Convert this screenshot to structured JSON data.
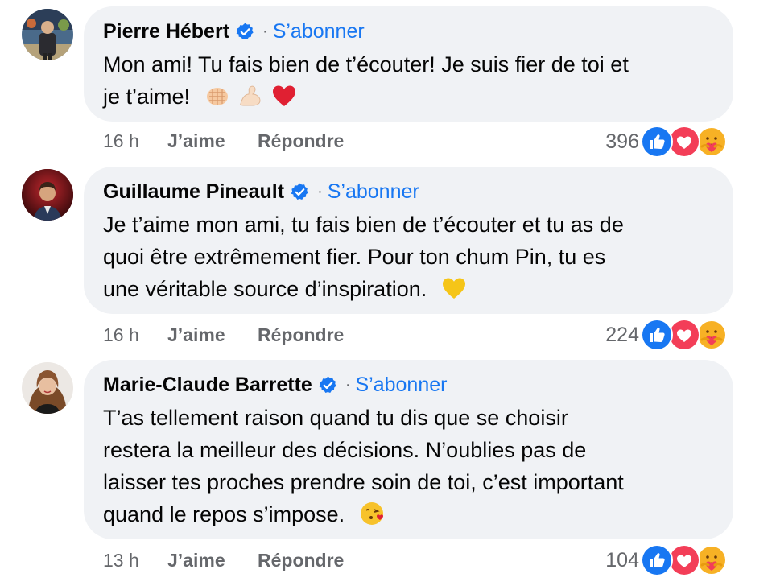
{
  "comments": [
    {
      "author": "Pierre Hébert",
      "follow_label": "S’abonner",
      "separator": "·",
      "text_lines": [
        "Mon ami! Tu fais bien de t’écouter! Je suis fier de toi et",
        "je t’aime!"
      ],
      "emojis": [
        "fist-bump-emoji",
        "flexed-biceps-emoji",
        "red-heart-emoji"
      ],
      "time": "16 h",
      "like_label": "J’aime",
      "reply_label": "Répondre",
      "reaction_count": "396",
      "reactions": [
        "like-reaction-icon",
        "love-reaction-icon",
        "care-reaction-icon"
      ]
    },
    {
      "author": "Guillaume Pineault",
      "follow_label": "S’abonner",
      "separator": "·",
      "text_lines": [
        "Je t’aime mon ami, tu fais bien de t’écouter et tu as de",
        "quoi être extrêmement fier. Pour ton chum Pin, tu es",
        "une véritable source d’inspiration."
      ],
      "emojis": [
        "yellow-heart-emoji"
      ],
      "time": "16 h",
      "like_label": "J’aime",
      "reply_label": "Répondre",
      "reaction_count": "224",
      "reactions": [
        "like-reaction-icon",
        "love-reaction-icon",
        "care-reaction-icon"
      ]
    },
    {
      "author": "Marie-Claude Barrette",
      "follow_label": "S’abonner",
      "separator": "·",
      "text_lines": [
        "T’as tellement raison quand tu dis que se choisir",
        "restera la meilleur des décisions. N’oublies pas de",
        "laisser tes proches prendre soin de toi, c’est important",
        "quand le repos s’impose."
      ],
      "emojis": [
        "face-blowing-kiss-emoji"
      ],
      "time": "13 h",
      "like_label": "J’aime",
      "reply_label": "Répondre",
      "reaction_count": "104",
      "reactions": [
        "like-reaction-icon",
        "love-reaction-icon",
        "care-reaction-icon"
      ]
    }
  ],
  "colors": {
    "bubble": "#f0f2f5",
    "link": "#1877f2",
    "muted": "#65676b",
    "like": "#1877f2",
    "love": "#f33e58",
    "care": "#f7b125"
  }
}
